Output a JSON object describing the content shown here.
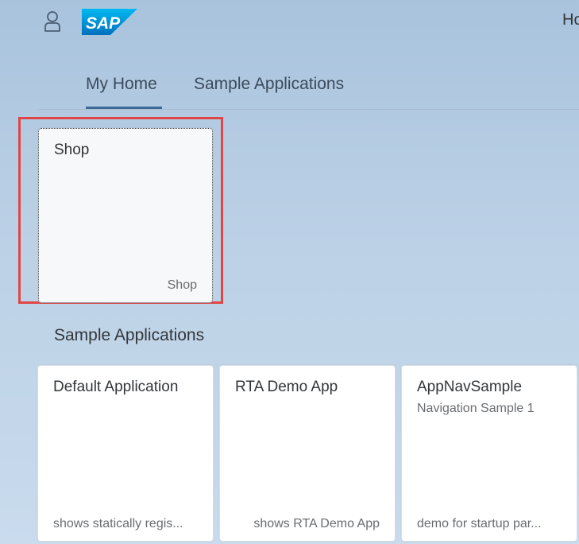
{
  "header": {
    "user_icon": "user-icon",
    "logo_text": "SAP",
    "title": "Ho"
  },
  "anchor_nav": {
    "items": [
      {
        "label": "My Home",
        "selected": true
      },
      {
        "label": "Sample Applications",
        "selected": false
      }
    ],
    "accent_color": "#3c6a96"
  },
  "my_home": {
    "tiles": [
      {
        "title": "Shop",
        "footer": "Shop",
        "highlighted": true
      }
    ],
    "highlight_color": "#e04646"
  },
  "sample_applications": {
    "title": "Sample Applications",
    "tiles": [
      {
        "title": "Default Application",
        "subtitle": "",
        "footer": "shows statically regis..."
      },
      {
        "title": "RTA Demo App",
        "subtitle": "",
        "footer": "shows RTA Demo App"
      },
      {
        "title": "AppNavSample",
        "subtitle": "Navigation Sample 1",
        "footer": "demo for startup par..."
      }
    ]
  }
}
